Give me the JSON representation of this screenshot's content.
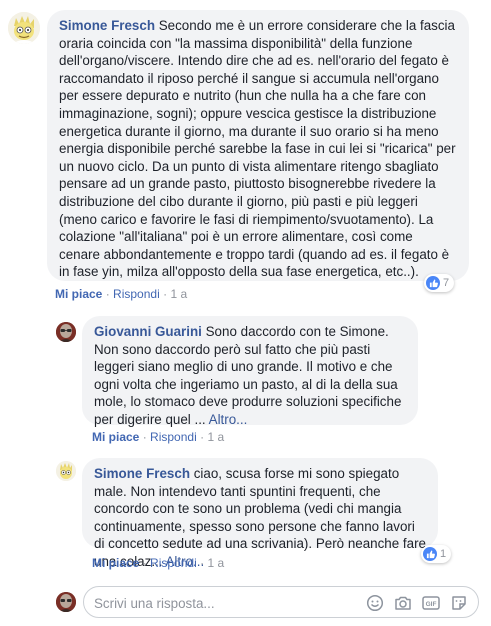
{
  "comments": [
    {
      "author": "Simone Fresch",
      "text": "Secondo me è un errore considerare che la fascia oraria coincida con \"la massima disponibilità\" della funzione dell'organo/viscere. Intendo dire che ad es. nell'orario del fegato è raccomandato il riposo perché il sangue si accumula nell'organo per essere depurato e nutrito (hun che nulla ha a che fare con immaginazione, sogni); oppure vescica gestisce la distribuzione energetica durante il giorno, ma durante il suo orario si ha meno energia disponibile perché sarebbe la fase in cui lei si \"ricarica\" per un nuovo ciclo. Da un punto di vista alimentare ritengo sbagliato pensare ad un grande pasto, piuttosto bisognerebbe rivedere la distribuzione del cibo durante il giorno, più pasti e più leggeri (meno carico e favorire le fasi di riempimento/svuotamento). La colazione \"all'italiana\" poi è un errore alimentare, così come cenare abbondantemente e troppo tardi (quando ad es. il fegato è in fase yin, milza all'opposto della sua fase energetica, etc..).",
      "like_label": "Mi piace",
      "reply_label": "Rispondi",
      "time": "1 a",
      "reaction_count": "7"
    },
    {
      "author": "Giovanni Guarini",
      "text": "Sono daccordo con te Simone. Non sono daccordo però sul fatto che più pasti leggeri siano meglio di uno grande. Il motivo e che ogni volta che ingeriamo un pasto, al di la della sua mole, lo stomaco deve produrre soluzioni specifiche per digerire quel ...",
      "more_label": "Altro...",
      "like_label": "Mi piace",
      "reply_label": "Rispondi",
      "time": "1 a"
    },
    {
      "author": "Simone Fresch",
      "text": "ciao, scusa forse mi sono spiegato male. Non intendevo tanti spuntini frequenti, che concordo con te sono un problema (vedi chi mangia continuamente, spesso sono persone che fanno lavori di concetto sedute ad una scrivania). Però neanche fare una colaz...",
      "more_label": "Altro...",
      "like_label": "Mi piace",
      "reply_label": "Rispondi",
      "time": "1 a",
      "reaction_count": "1"
    }
  ],
  "reply_box": {
    "placeholder": "Scrivi una risposta..."
  },
  "separator": "·",
  "icons": [
    "like-icon",
    "emoji-icon",
    "camera-icon",
    "gif-icon",
    "sticker-icon"
  ],
  "colors": {
    "link": "#385898",
    "action": "#4267b2",
    "meta": "#90949c",
    "bubble": "#f2f3f5",
    "like_badge": "#4a86f7"
  }
}
